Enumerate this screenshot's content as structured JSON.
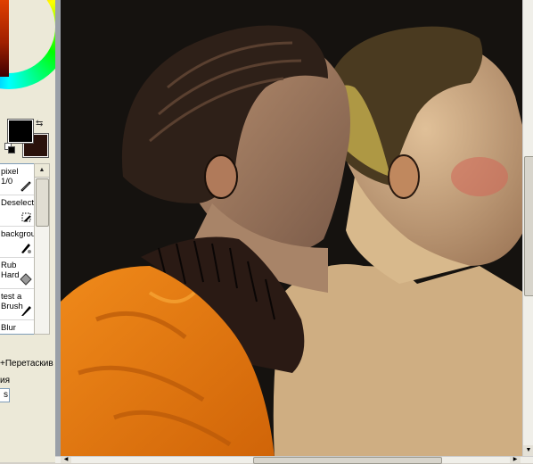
{
  "colors": {
    "foreground": "#000000",
    "background": "#2a120c",
    "canvas_bg": "#141210",
    "orange_jacket": "#e87a12",
    "skin": "#c9a07a"
  },
  "brushes": [
    {
      "label": "pixel\n1/0",
      "icon": "pencil-icon"
    },
    {
      "label": "Deselect",
      "icon": "magic-wand-icon"
    },
    {
      "label": "backgrou",
      "icon": "brush-icon"
    },
    {
      "label": "Rub\nHard",
      "icon": "eraser-icon"
    },
    {
      "label": "test a\nBrush",
      "icon": "brush-icon"
    },
    {
      "label": "Blur\nx",
      "icon": "blur-icon"
    }
  ],
  "status_text": "+Перетаскив",
  "combo_label": "ия",
  "combo_value": "s"
}
